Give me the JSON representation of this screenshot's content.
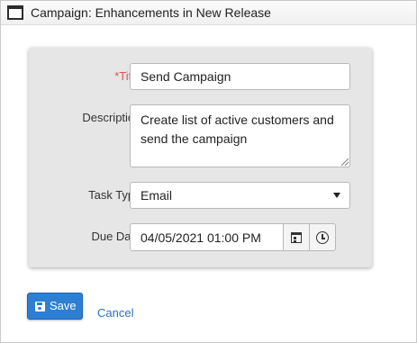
{
  "window": {
    "title": "Campaign: Enhancements in New Release"
  },
  "form": {
    "title_label": "*Title:",
    "title_value": "Send Campaign",
    "description_label": "Description:",
    "description_value": "Create list of active customers and send the campaign",
    "task_type_label": "Task Type:",
    "task_type_value": "Email",
    "due_date_label": "Due Date:",
    "due_date_value": "04/05/2021 01:00 PM"
  },
  "actions": {
    "save_label": "Save",
    "cancel_label": "Cancel"
  },
  "icons": {
    "window": "window-icon",
    "dropdown": "chevron-down-icon",
    "calendar": "calendar-icon",
    "clock": "clock-icon",
    "save": "floppy-disk-icon"
  },
  "colors": {
    "required_label": "#e4524e",
    "primary_button": "#2d7fd3",
    "link": "#2a6fc0",
    "panel_background": "#e6e6e6"
  }
}
